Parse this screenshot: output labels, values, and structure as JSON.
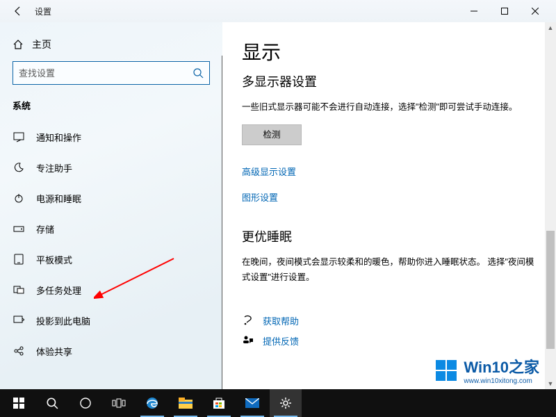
{
  "window": {
    "title": "设置"
  },
  "sidebar": {
    "home": "主页",
    "search_placeholder": "查找设置",
    "section": "系统",
    "items": [
      {
        "label": "通知和操作"
      },
      {
        "label": "专注助手"
      },
      {
        "label": "电源和睡眠"
      },
      {
        "label": "存储"
      },
      {
        "label": "平板模式"
      },
      {
        "label": "多任务处理"
      },
      {
        "label": "投影到此电脑"
      },
      {
        "label": "体验共享"
      }
    ]
  },
  "content": {
    "h1": "显示",
    "h2a": "多显示器设置",
    "desc1": "一些旧式显示器可能不会进行自动连接，选择\"检测\"即可尝试手动连接。",
    "detect_btn": "检测",
    "link_adv": "高级显示设置",
    "link_gfx": "图形设置",
    "h2b": "更优睡眠",
    "desc2": "在晚间，夜间模式会显示较柔和的暖色，帮助你进入睡眠状态。 选择\"夜间模式设置\"进行设置。",
    "help": "获取帮助",
    "feedback": "提供反馈"
  },
  "watermark": {
    "brand": "Win10之家",
    "url": "www.win10xitong.com"
  }
}
